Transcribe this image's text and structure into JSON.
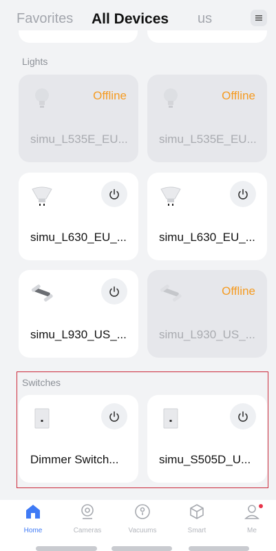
{
  "tabs": {
    "favorites": "Favorites",
    "all_devices": "All Devices",
    "us": "us"
  },
  "sections": {
    "lights": "Lights",
    "switches": "Switches"
  },
  "lights": [
    {
      "name": "simu_L535E_EU...",
      "status": "Offline",
      "icon": "bulb-icon"
    },
    {
      "name": "simu_L535E_EU...",
      "status": "Offline",
      "icon": "bulb-icon"
    },
    {
      "name": "simu_L630_EU_...",
      "status": "",
      "icon": "spotlight-bulb-icon"
    },
    {
      "name": "simu_L630_EU_...",
      "status": "",
      "icon": "spotlight-bulb-icon"
    },
    {
      "name": "simu_L930_US_...",
      "status": "",
      "icon": "light-strip-icon"
    },
    {
      "name": "simu_L930_US_...",
      "status": "Offline",
      "icon": "light-strip-icon"
    }
  ],
  "switches": [
    {
      "name": "Dimmer Switch...",
      "icon": "wall-switch-icon"
    },
    {
      "name": "simu_S505D_U...",
      "icon": "wall-switch-icon"
    }
  ],
  "nav": {
    "home": "Home",
    "cameras": "Cameras",
    "vacuums": "Vacuums",
    "smart": "Smart",
    "me": "Me"
  },
  "colors": {
    "accent": "#3f7af5",
    "offline": "#f59b21",
    "highlight": "#cc2b3b"
  }
}
